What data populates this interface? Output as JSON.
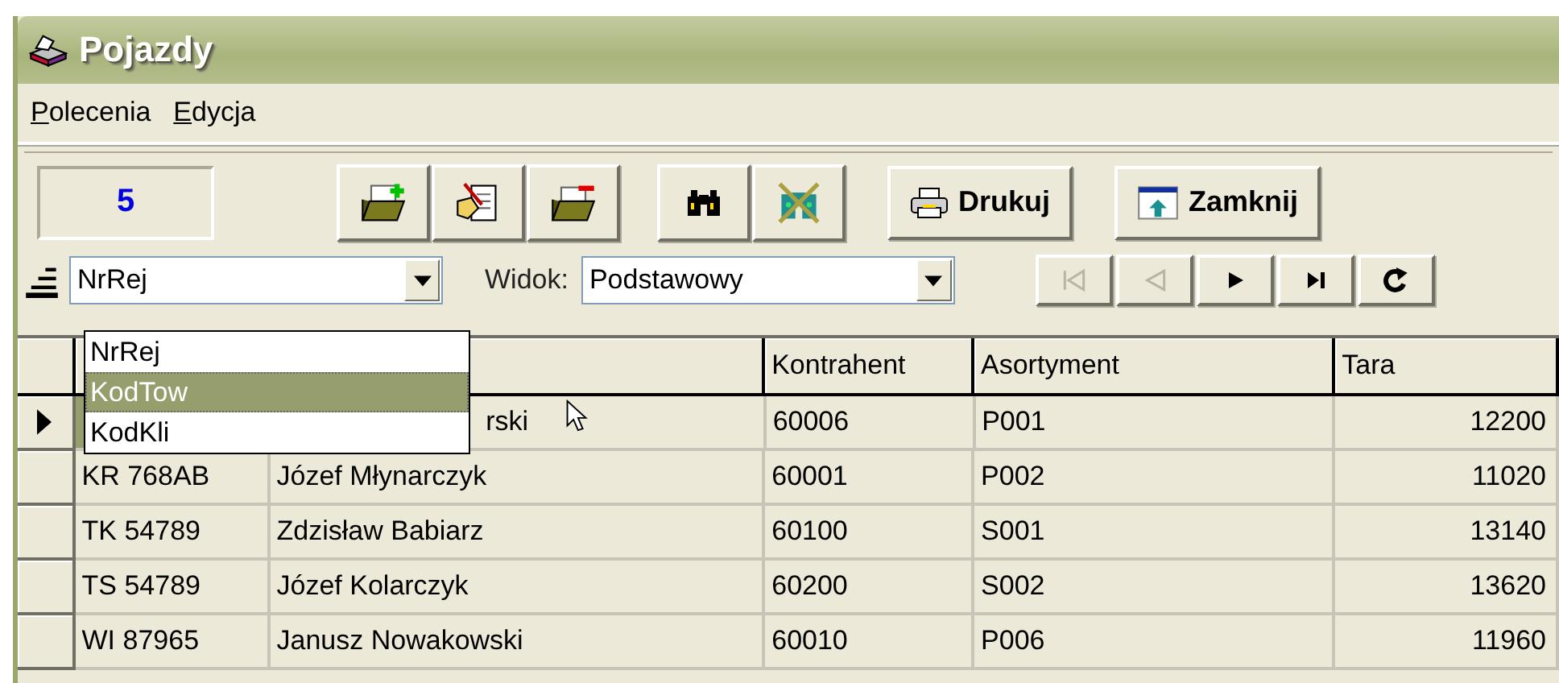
{
  "window": {
    "title": "Pojazdy"
  },
  "menu": [
    {
      "label": "Polecenia"
    },
    {
      "label": "Edycja"
    }
  ],
  "toolbar": {
    "record_count": "5",
    "icon_buttons": [
      {
        "kind": "add"
      },
      {
        "kind": "edit"
      },
      {
        "kind": "remove"
      },
      {
        "kind": "find"
      },
      {
        "kind": "clear-find"
      }
    ],
    "text_buttons": [
      {
        "kind": "print",
        "label": "Drukuj"
      },
      {
        "kind": "close",
        "label": "Zamknij"
      }
    ]
  },
  "filter_bar": {
    "sort_field": "NrRej",
    "view_label": "Widok:",
    "view": "Podstawowy",
    "nav_buttons": [
      {
        "kind": "first",
        "disabled": true
      },
      {
        "kind": "prev",
        "disabled": true
      },
      {
        "kind": "next",
        "disabled": false
      },
      {
        "kind": "last",
        "disabled": false
      },
      {
        "kind": "refresh",
        "disabled": false
      }
    ]
  },
  "sort_dropdown": {
    "items": [
      {
        "label": "NrRej",
        "selected": false
      },
      {
        "label": "KodTow",
        "selected": true
      },
      {
        "label": "KodKli",
        "selected": false
      }
    ]
  },
  "table": {
    "columns": [
      null,
      null,
      "Kontrahent",
      "Asortyment",
      "Tara"
    ],
    "rows": [
      {
        "current": true,
        "cells": [
          null,
          "rski",
          "60006",
          "P001",
          "12200"
        ]
      },
      {
        "current": false,
        "cells": [
          "KR 768AB",
          "Józef Młynarczyk",
          "60001",
          "P002",
          "11020"
        ]
      },
      {
        "current": false,
        "cells": [
          "TK 54789",
          "Zdzisław Babiarz",
          "60100",
          "S001",
          "13140"
        ]
      },
      {
        "current": false,
        "cells": [
          "TS 54789",
          "Józef Kolarczyk",
          "60200",
          "S002",
          "13620"
        ]
      },
      {
        "current": false,
        "cells": [
          "WI 87965",
          "Janusz Nowakowski",
          "60010",
          "P006",
          "11960"
        ]
      }
    ]
  }
}
